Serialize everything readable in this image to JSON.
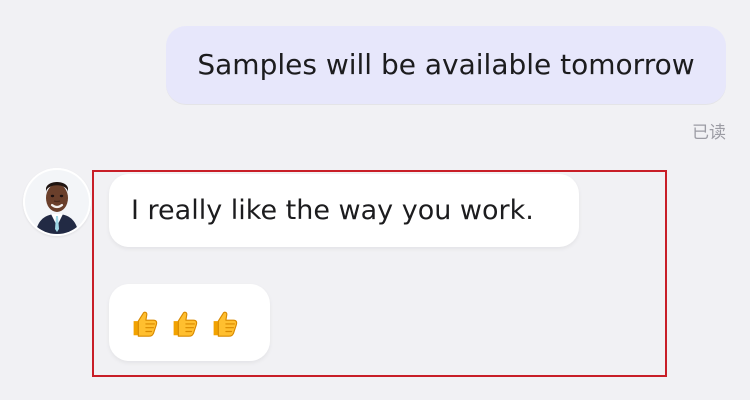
{
  "conversation": {
    "outgoing_message": "Samples will be available tomorrow",
    "read_receipt": "已读",
    "incoming_messages": {
      "text": "I really like the way you work.",
      "emoji_reaction": {
        "icon": "thumbs-up-icon",
        "count": 3
      }
    }
  },
  "colors": {
    "background": "#f1f1f4",
    "outgoing_bubble": "#e7e7fb",
    "incoming_bubble": "#ffffff",
    "highlight_border": "#c81e27",
    "emoji_fill": "#ffbf2f"
  }
}
